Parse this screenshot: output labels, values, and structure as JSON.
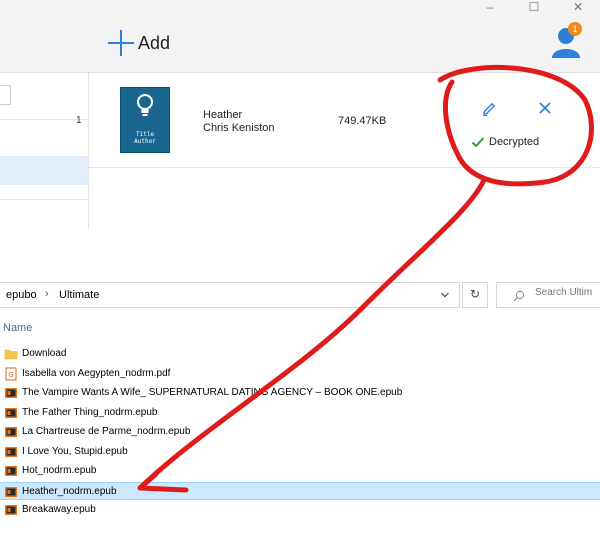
{
  "app": {
    "window_controls": [
      "–",
      "☐",
      "✕"
    ],
    "add_label": "Add",
    "notification_count": "1",
    "accent": "#2f7ed8",
    "book": {
      "row_number": "1",
      "cover_lines": [
        "Title",
        "Author"
      ],
      "title": "Heather",
      "author": "Chris Keniston",
      "size": "749.47KB",
      "status": "Decrypted",
      "status_color": "#2aa03a"
    }
  },
  "explorer": {
    "breadcrumb": {
      "root": "epubo",
      "separator": "›",
      "current": "Ultimate"
    },
    "search_placeholder": "Search Ultim",
    "column_name": "Name",
    "files": [
      {
        "name": "Download",
        "icon": "folder-icon"
      },
      {
        "name": "Isabella von Aegypten_nodrm.pdf",
        "icon": "pdf-file-icon"
      },
      {
        "name": "The Vampire Wants A Wife_ SUPERNATURAL DATING AGENCY – BOOK ONE.epub",
        "icon": "epub-file-icon"
      },
      {
        "name": "The Father Thing_nodrm.epub",
        "icon": "epub-file-icon"
      },
      {
        "name": "La Chartreuse de Parme_nodrm.epub",
        "icon": "epub-file-icon"
      },
      {
        "name": "I Love You, Stupid.epub",
        "icon": "epub-file-icon"
      },
      {
        "name": "Hot_nodrm.epub",
        "icon": "epub-file-icon"
      },
      {
        "name": "Heather_nodrm.epub",
        "icon": "epub-file-icon",
        "selected": true
      },
      {
        "name": "Breakaway.epub",
        "icon": "epub-file-icon"
      }
    ]
  }
}
